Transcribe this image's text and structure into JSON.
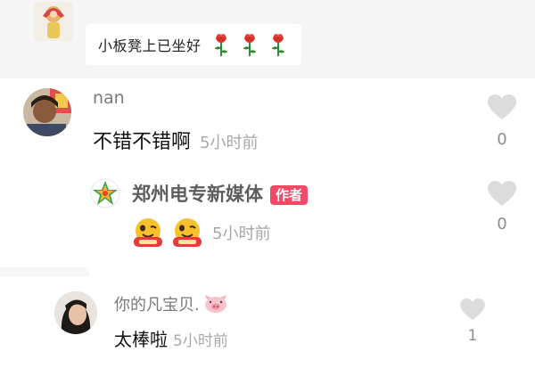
{
  "top_reply": {
    "text": "小板凳上已坐好"
  },
  "comment1": {
    "username": "nan",
    "text": "不错不错啊",
    "time": "5小时前",
    "likes": "0"
  },
  "reply1": {
    "username": "郑州电专新媒体",
    "badge": "作者",
    "time": "5小时前",
    "likes": "0"
  },
  "reply2": {
    "username": "你的凡宝贝.",
    "text": "太棒啦",
    "time": "5小时前",
    "likes": "1"
  },
  "colors": {
    "badge": "#f14a66",
    "rose": "#d8302a",
    "stem": "#2e8b2e",
    "heart": "#dcdcdc"
  },
  "icons": [
    "rose-icon",
    "heart-icon",
    "pig-icon",
    "emoji-sticker-icon"
  ]
}
